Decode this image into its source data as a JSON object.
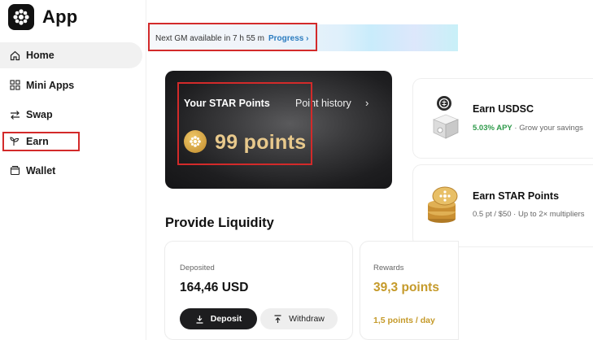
{
  "app": {
    "title": "App"
  },
  "sidebar": {
    "items": [
      {
        "label": "Home",
        "icon": "home-icon",
        "active": true
      },
      {
        "label": "Mini Apps",
        "icon": "grid-icon"
      },
      {
        "label": "Swap",
        "icon": "swap-icon"
      },
      {
        "label": "Earn",
        "icon": "sprout-icon",
        "highlighted": true
      },
      {
        "label": "Wallet",
        "icon": "wallet-icon"
      }
    ]
  },
  "banner": {
    "text": "Next GM available in 7 h 55 m",
    "link": "Progress"
  },
  "star_card": {
    "title": "Your STAR Points",
    "history_link": "Point history",
    "points": "99 points"
  },
  "right_cards": [
    {
      "title": "Earn USDSC",
      "apy": "5.03% APY",
      "subtitle": " · Grow your savings"
    },
    {
      "title": "Earn STAR Points",
      "subtitle": "0.5 pt / $50 · Up to 2× multipliers"
    }
  ],
  "liquidity": {
    "title": "Provide Liquidity",
    "deposited_label": "Deposited",
    "deposited_value": "164,46 USD",
    "deposit_button": "Deposit",
    "withdraw_button": "Withdraw",
    "rewards_label": "Rewards",
    "rewards_value": "39,3 points",
    "rewards_rate": "1,5 points / day"
  },
  "colors": {
    "highlight": "#d32a2a",
    "gold": "#c59a2a",
    "apy_green": "#2e9a4a",
    "link_blue": "#2a7bbf"
  }
}
